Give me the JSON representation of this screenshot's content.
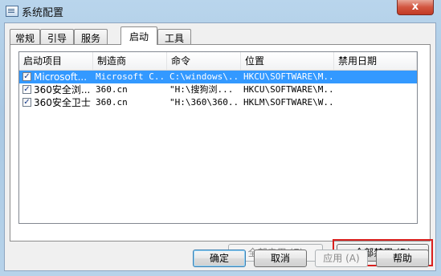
{
  "window": {
    "title": "系统配置",
    "close_label": "x"
  },
  "tabs": [
    "常规",
    "引导",
    "服务",
    "启动",
    "工具"
  ],
  "active_tab": 3,
  "list": {
    "columns": [
      "启动项目",
      "制造商",
      "命令",
      "位置",
      "禁用日期"
    ],
    "rows": [
      {
        "checked": true,
        "selected": true,
        "item": "Microsoft...",
        "maker": "Microsoft C...",
        "command": "C:\\windows\\...",
        "location": "HKCU\\SOFTWARE\\M...",
        "disabled_date": ""
      },
      {
        "checked": true,
        "selected": false,
        "item": "360安全浏...",
        "maker": "360.cn",
        "command": "\"H:\\搜狗浏...",
        "location": "HKCU\\SOFTWARE\\M...",
        "disabled_date": ""
      },
      {
        "checked": true,
        "selected": false,
        "item": "360安全卫士",
        "maker": "360.cn",
        "command": "\"H:\\360\\360...",
        "location": "HKLM\\SOFTWARE\\W...",
        "disabled_date": ""
      }
    ]
  },
  "buttons": {
    "enable_all": "全部启用 (E)",
    "disable_all": "全部禁用 (D)",
    "ok": "确定",
    "cancel": "取消",
    "apply": "应用 (A)",
    "help": "帮助"
  },
  "colors": {
    "selection": "#3399ff",
    "highlight": "#d9201e"
  }
}
